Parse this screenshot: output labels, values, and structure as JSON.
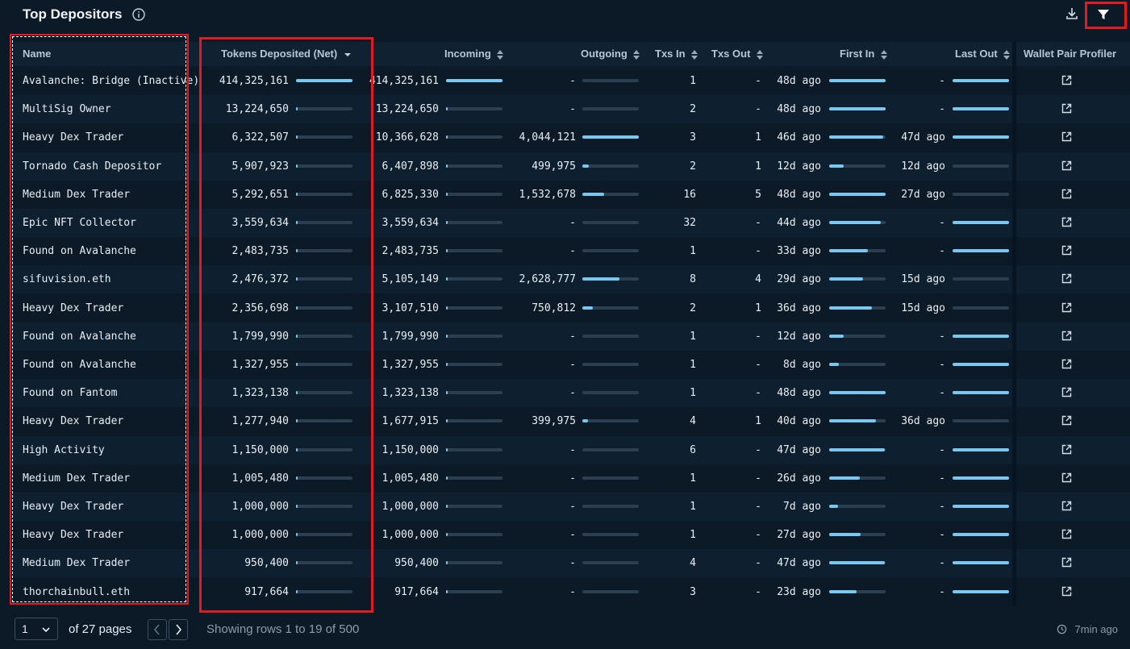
{
  "header": {
    "title": "Top Depositors"
  },
  "columns": {
    "name": "Name",
    "tokens_net": "Tokens Deposited (Net)",
    "incoming": "Incoming",
    "outgoing": "Outgoing",
    "txs_in": "Txs In",
    "txs_out": "Txs Out",
    "first_in": "First In",
    "last_out": "Last Out",
    "profiler": "Wallet Pair Profiler"
  },
  "rows": [
    {
      "name": "Avalanche: Bridge (Inactive)",
      "net": "414,325,161",
      "net_frac": 1.0,
      "incoming": "414,325,161",
      "in_frac": 1.0,
      "outgoing": "-",
      "out_frac": 0,
      "txs_in": "1",
      "txs_out": "-",
      "first_in": "48d ago",
      "first_frac": 1.0,
      "last_out": "-",
      "last_frac": 1.0
    },
    {
      "name": "MultiSig Owner",
      "net": "13,224,650",
      "net_frac": 0.03,
      "incoming": "13,224,650",
      "in_frac": 0.03,
      "outgoing": "-",
      "out_frac": 0,
      "txs_in": "2",
      "txs_out": "-",
      "first_in": "48d ago",
      "first_frac": 1.0,
      "last_out": "-",
      "last_frac": 1.0
    },
    {
      "name": "Heavy Dex Trader",
      "net": "6,322,507",
      "net_frac": 0.015,
      "incoming": "10,366,628",
      "in_frac": 0.025,
      "outgoing": "4,044,121",
      "out_frac": 1.0,
      "txs_in": "3",
      "txs_out": "1",
      "first_in": "46d ago",
      "first_frac": 0.96,
      "last_out": "47d ago",
      "last_frac": 1.0
    },
    {
      "name": "Tornado Cash Depositor",
      "net": "5,907,923",
      "net_frac": 0.014,
      "incoming": "6,407,898",
      "in_frac": 0.015,
      "outgoing": "499,975",
      "out_frac": 0.12,
      "txs_in": "2",
      "txs_out": "1",
      "first_in": "12d ago",
      "first_frac": 0.25,
      "last_out": "12d ago",
      "last_frac": 0.0
    },
    {
      "name": "Medium Dex Trader",
      "net": "5,292,651",
      "net_frac": 0.013,
      "incoming": "6,825,330",
      "in_frac": 0.016,
      "outgoing": "1,532,678",
      "out_frac": 0.38,
      "txs_in": "16",
      "txs_out": "5",
      "first_in": "48d ago",
      "first_frac": 1.0,
      "last_out": "27d ago",
      "last_frac": 0.0
    },
    {
      "name": "Epic NFT Collector",
      "net": "3,559,634",
      "net_frac": 0.009,
      "incoming": "3,559,634",
      "in_frac": 0.009,
      "outgoing": "-",
      "out_frac": 0,
      "txs_in": "32",
      "txs_out": "-",
      "first_in": "44d ago",
      "first_frac": 0.92,
      "last_out": "-",
      "last_frac": 1.0
    },
    {
      "name": "Found on Avalanche",
      "net": "2,483,735",
      "net_frac": 0.006,
      "incoming": "2,483,735",
      "in_frac": 0.006,
      "outgoing": "-",
      "out_frac": 0,
      "txs_in": "1",
      "txs_out": "-",
      "first_in": "33d ago",
      "first_frac": 0.68,
      "last_out": "-",
      "last_frac": 1.0
    },
    {
      "name": "sifuvision.eth",
      "net": "2,476,372",
      "net_frac": 0.006,
      "incoming": "5,105,149",
      "in_frac": 0.012,
      "outgoing": "2,628,777",
      "out_frac": 0.65,
      "txs_in": "8",
      "txs_out": "4",
      "first_in": "29d ago",
      "first_frac": 0.6,
      "last_out": "15d ago",
      "last_frac": 0.0
    },
    {
      "name": "Heavy Dex Trader",
      "net": "2,356,698",
      "net_frac": 0.006,
      "incoming": "3,107,510",
      "in_frac": 0.007,
      "outgoing": "750,812",
      "out_frac": 0.18,
      "txs_in": "2",
      "txs_out": "1",
      "first_in": "36d ago",
      "first_frac": 0.75,
      "last_out": "15d ago",
      "last_frac": 0.0
    },
    {
      "name": "Found on Avalanche",
      "net": "1,799,990",
      "net_frac": 0.004,
      "incoming": "1,799,990",
      "in_frac": 0.004,
      "outgoing": "-",
      "out_frac": 0,
      "txs_in": "1",
      "txs_out": "-",
      "first_in": "12d ago",
      "first_frac": 0.25,
      "last_out": "-",
      "last_frac": 1.0
    },
    {
      "name": "Found on Avalanche",
      "net": "1,327,955",
      "net_frac": 0.003,
      "incoming": "1,327,955",
      "in_frac": 0.003,
      "outgoing": "-",
      "out_frac": 0,
      "txs_in": "1",
      "txs_out": "-",
      "first_in": "8d ago",
      "first_frac": 0.17,
      "last_out": "-",
      "last_frac": 1.0
    },
    {
      "name": "Found on Fantom",
      "net": "1,323,138",
      "net_frac": 0.003,
      "incoming": "1,323,138",
      "in_frac": 0.003,
      "outgoing": "-",
      "out_frac": 0,
      "txs_in": "1",
      "txs_out": "-",
      "first_in": "48d ago",
      "first_frac": 1.0,
      "last_out": "-",
      "last_frac": 1.0
    },
    {
      "name": "Heavy Dex Trader",
      "net": "1,277,940",
      "net_frac": 0.003,
      "incoming": "1,677,915",
      "in_frac": 0.004,
      "outgoing": "399,975",
      "out_frac": 0.1,
      "txs_in": "4",
      "txs_out": "1",
      "first_in": "40d ago",
      "first_frac": 0.83,
      "last_out": "36d ago",
      "last_frac": 0.0
    },
    {
      "name": "High Activity",
      "net": "1,150,000",
      "net_frac": 0.003,
      "incoming": "1,150,000",
      "in_frac": 0.003,
      "outgoing": "-",
      "out_frac": 0,
      "txs_in": "6",
      "txs_out": "-",
      "first_in": "47d ago",
      "first_frac": 0.98,
      "last_out": "-",
      "last_frac": 1.0
    },
    {
      "name": "Medium Dex Trader",
      "net": "1,005,480",
      "net_frac": 0.002,
      "incoming": "1,005,480",
      "in_frac": 0.002,
      "outgoing": "-",
      "out_frac": 0,
      "txs_in": "1",
      "txs_out": "-",
      "first_in": "26d ago",
      "first_frac": 0.54,
      "last_out": "-",
      "last_frac": 1.0
    },
    {
      "name": "Heavy Dex Trader",
      "net": "1,000,000",
      "net_frac": 0.002,
      "incoming": "1,000,000",
      "in_frac": 0.002,
      "outgoing": "-",
      "out_frac": 0,
      "txs_in": "1",
      "txs_out": "-",
      "first_in": "7d ago",
      "first_frac": 0.15,
      "last_out": "-",
      "last_frac": 1.0
    },
    {
      "name": "Heavy Dex Trader",
      "net": "1,000,000",
      "net_frac": 0.002,
      "incoming": "1,000,000",
      "in_frac": 0.002,
      "outgoing": "-",
      "out_frac": 0,
      "txs_in": "1",
      "txs_out": "-",
      "first_in": "27d ago",
      "first_frac": 0.56,
      "last_out": "-",
      "last_frac": 1.0
    },
    {
      "name": "Medium Dex Trader",
      "net": "950,400",
      "net_frac": 0.002,
      "incoming": "950,400",
      "in_frac": 0.002,
      "outgoing": "-",
      "out_frac": 0,
      "txs_in": "4",
      "txs_out": "-",
      "first_in": "47d ago",
      "first_frac": 0.98,
      "last_out": "-",
      "last_frac": 1.0
    },
    {
      "name": "thorchainbull.eth",
      "net": "917,664",
      "net_frac": 0.002,
      "incoming": "917,664",
      "in_frac": 0.002,
      "outgoing": "-",
      "out_frac": 0,
      "txs_in": "3",
      "txs_out": "-",
      "first_in": "23d ago",
      "first_frac": 0.48,
      "last_out": "-",
      "last_frac": 1.0
    }
  ],
  "footer": {
    "page_value": "1",
    "pages_text": "of 27 pages",
    "showing": "Showing rows 1 to 19 of 500",
    "updated": "7min ago"
  },
  "colors": {
    "accent_bar": "#7ac8ef",
    "highlight": "#e01b22"
  },
  "icons": [
    "info-icon",
    "download-icon",
    "filter-icon",
    "sort-icon",
    "external-link-icon",
    "chevron-down-icon",
    "chevron-left-icon",
    "chevron-right-icon",
    "clock-icon"
  ]
}
